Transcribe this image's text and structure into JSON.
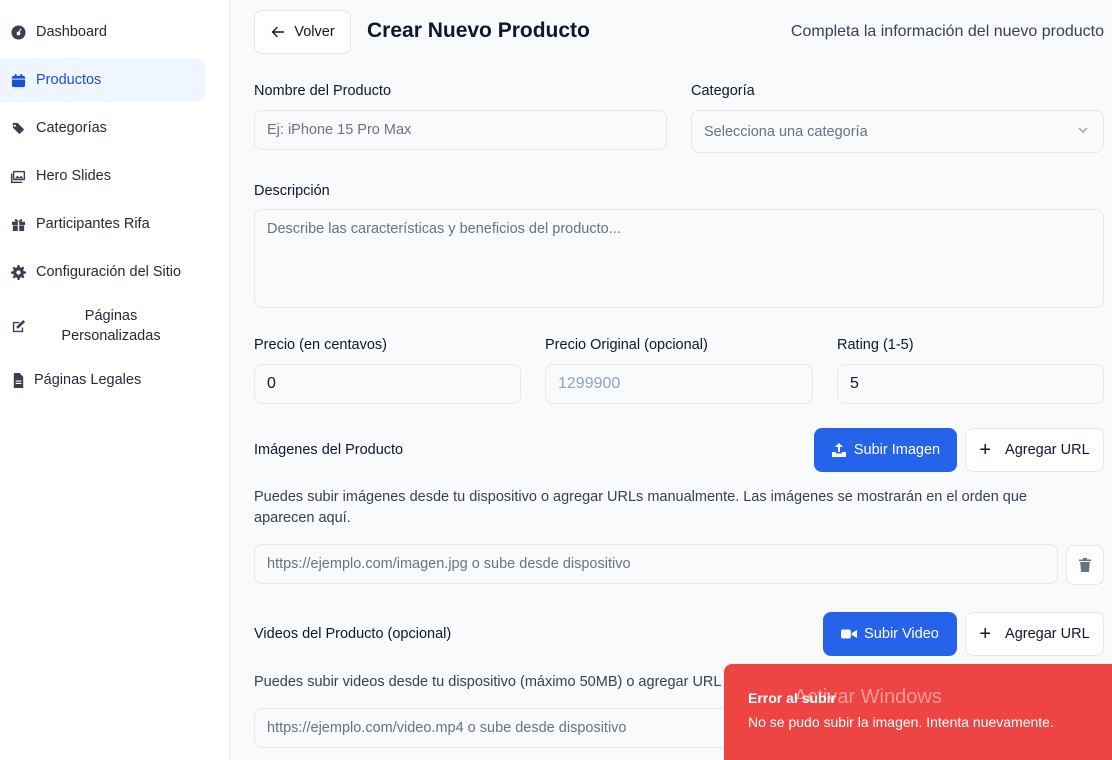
{
  "sidebar": {
    "items": [
      {
        "label": "Dashboard",
        "icon": "dashboard-icon"
      },
      {
        "label": "Productos",
        "icon": "calendar-icon",
        "active": true
      },
      {
        "label": "Categorías",
        "icon": "tags-icon"
      },
      {
        "label": "Hero Slides",
        "icon": "images-icon"
      },
      {
        "label": "Participantes Rifa",
        "icon": "gift-icon"
      },
      {
        "label": "Configuración del Sitio",
        "icon": "gear-icon"
      },
      {
        "label": "Páginas Personalizadas",
        "icon": "edit-icon"
      },
      {
        "label": "Páginas Legales",
        "icon": "file-icon"
      }
    ]
  },
  "header": {
    "back_label": "Volver",
    "title": "Crear Nuevo Producto",
    "subtitle": "Completa la información del nuevo producto"
  },
  "form": {
    "name": {
      "label": "Nombre del Producto",
      "placeholder": "Ej: iPhone 15 Pro Max"
    },
    "category": {
      "label": "Categoría",
      "placeholder": "Selecciona una categoría"
    },
    "description": {
      "label": "Descripción",
      "placeholder": "Describe las características y beneficios del producto..."
    },
    "price": {
      "label": "Precio (en centavos)",
      "value": "0"
    },
    "original_price": {
      "label": "Precio Original (opcional)",
      "placeholder": "1299900"
    },
    "rating": {
      "label": "Rating (1-5)",
      "value": "5"
    },
    "images": {
      "label": "Imágenes del Producto",
      "upload_label": "Subir Imagen",
      "add_url_label": "Agregar URL",
      "help": "Puedes subir imágenes desde tu dispositivo o agregar URLs manualmente. Las imágenes se mostrarán en el orden que aparecen aquí.",
      "url_placeholder": "https://ejemplo.com/imagen.jpg o sube desde dispositivo"
    },
    "videos": {
      "label": "Videos del Producto (opcional)",
      "upload_label": "Subir Video",
      "add_url_label": "Agregar URL",
      "help": "Puedes subir videos desde tu dispositivo (máximo 50MB) o agregar URL",
      "url_placeholder": "https://ejemplo.com/video.mp4 o sube desde dispositivo"
    }
  },
  "toast": {
    "title": "Error al subir",
    "message": "No se pudo subir la imagen. Intenta nuevamente.",
    "color": "#ef4444"
  },
  "watermark": "Activar Windows",
  "colors": {
    "accent": "#2563eb",
    "active_bg": "#eff6ff",
    "error": "#ef4444"
  }
}
